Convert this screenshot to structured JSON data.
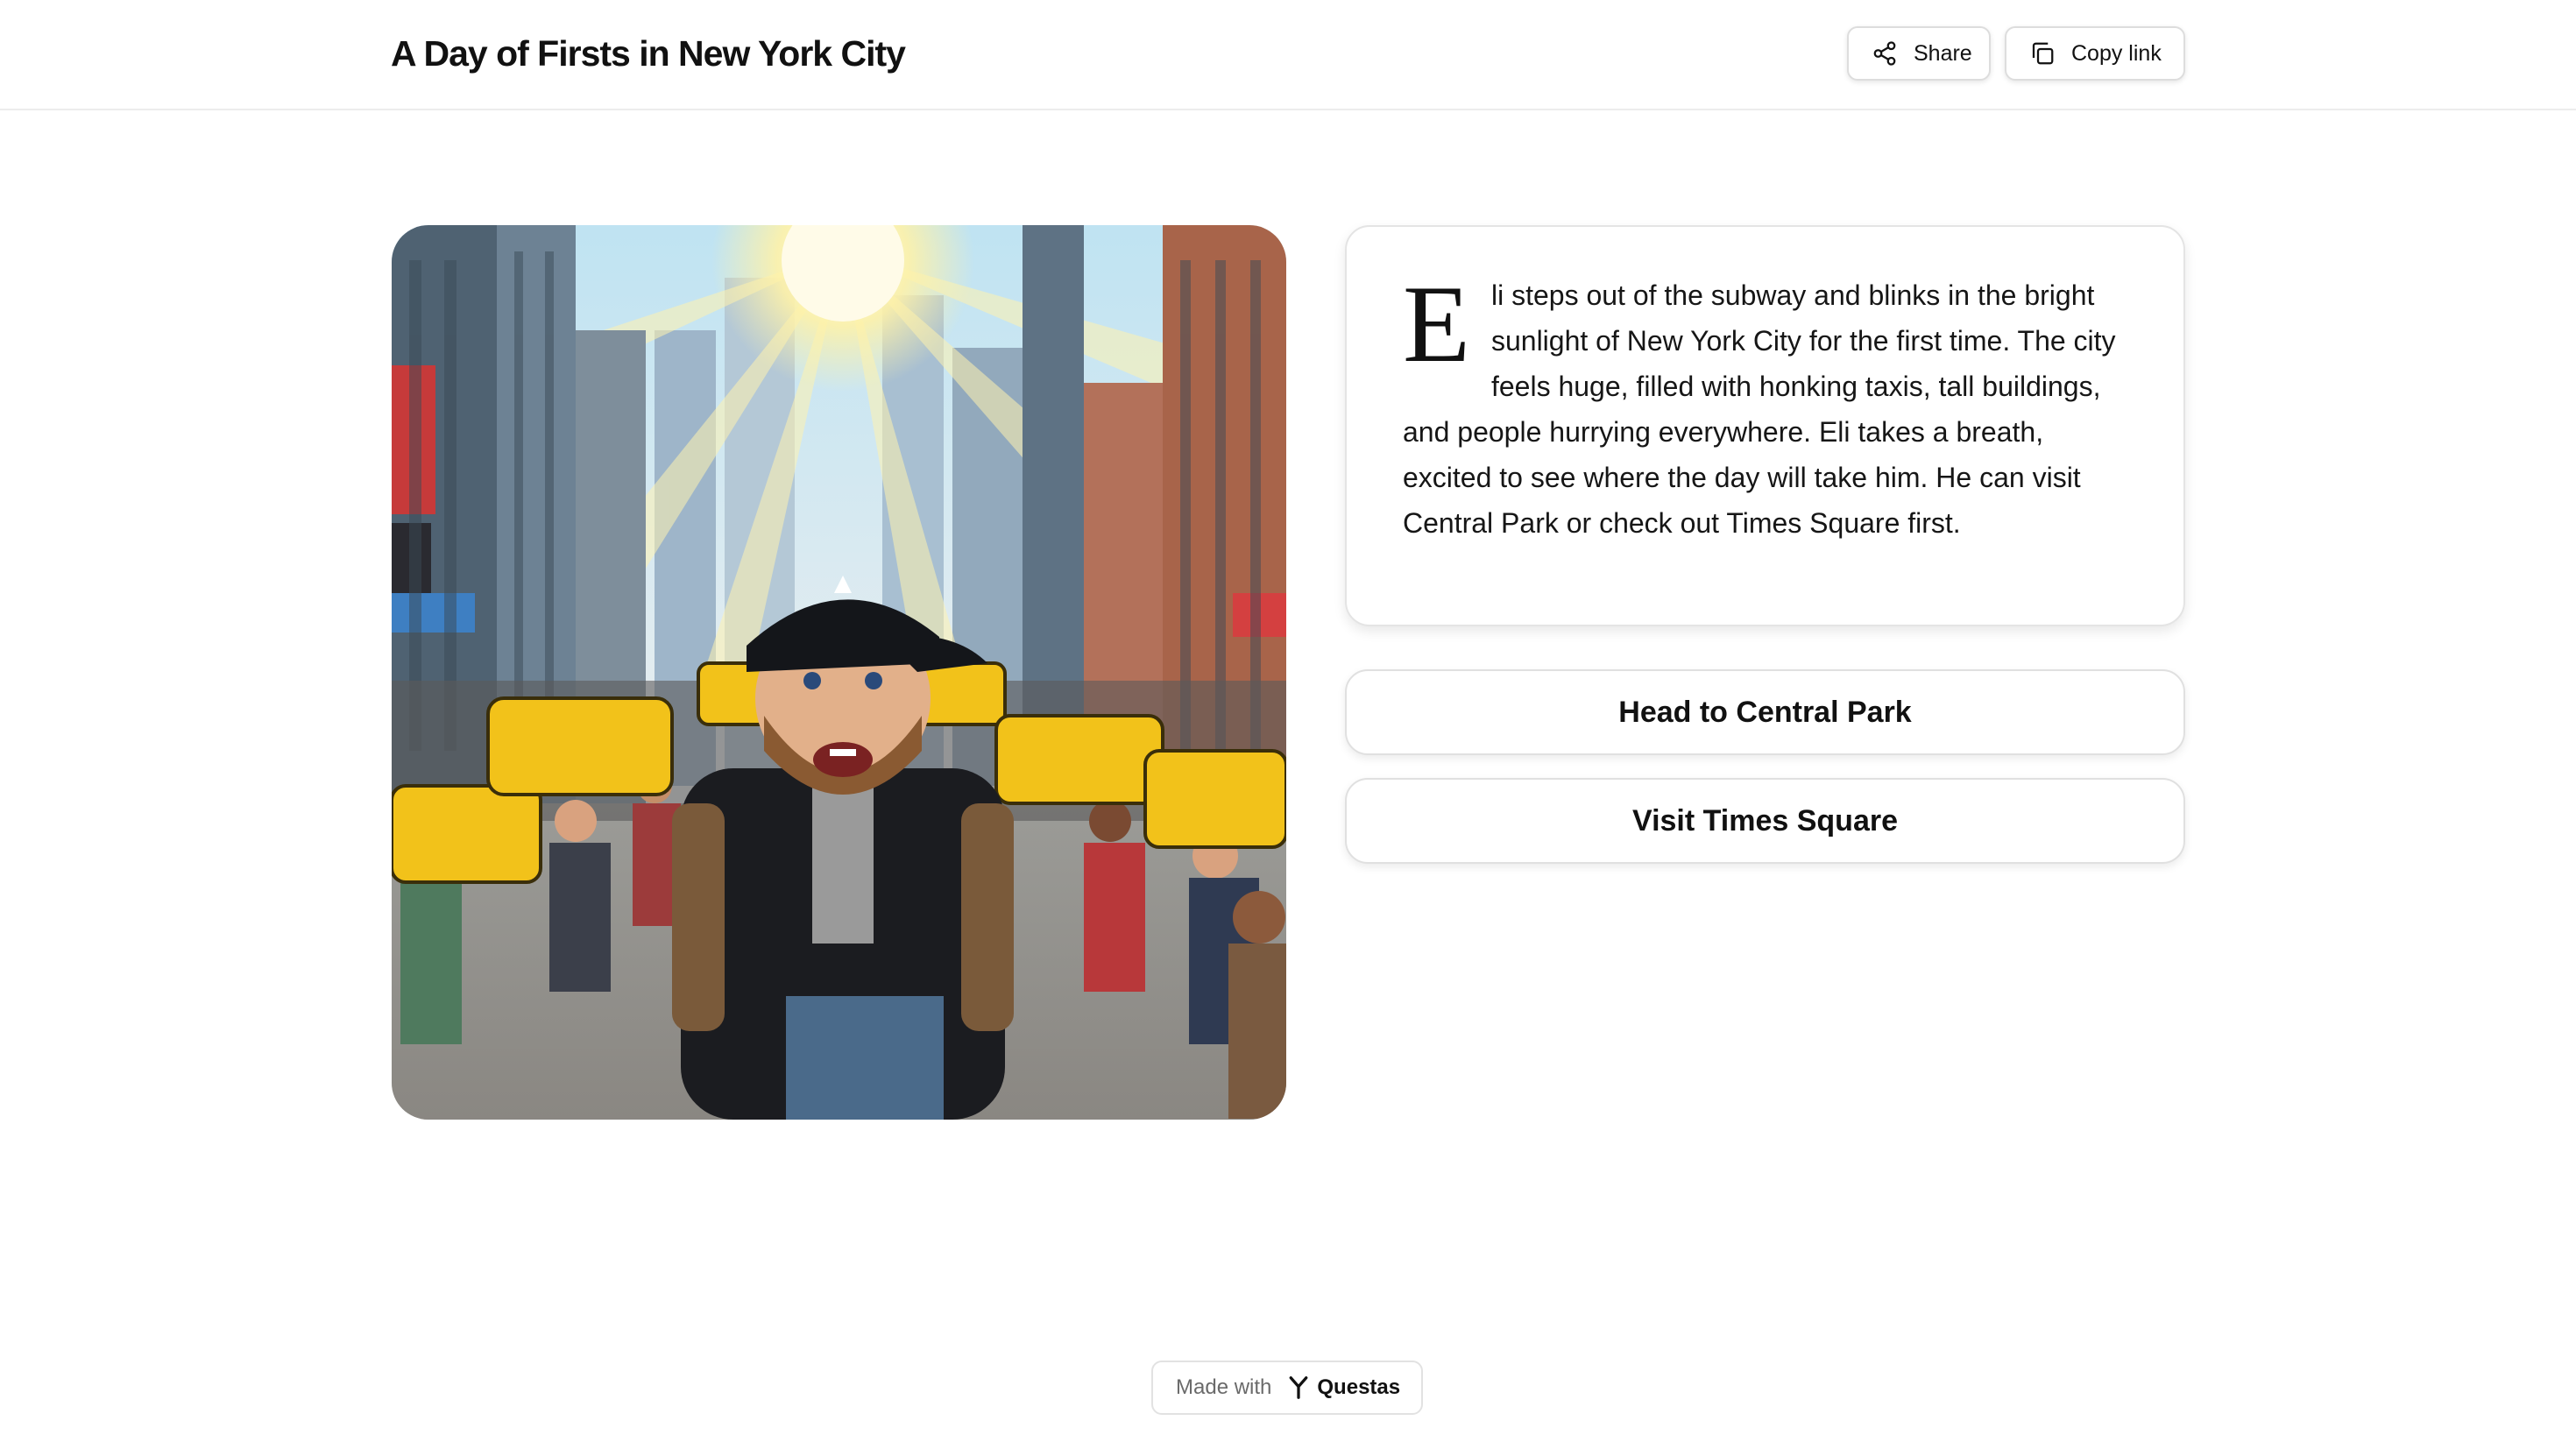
{
  "header": {
    "title": "A Day of Firsts in New York City",
    "share_label": "Share",
    "copy_link_label": "Copy link"
  },
  "story": {
    "drop_cap": "E",
    "text": "li steps out of the subway and blinks in the bright sunlight of New York City for the first time. The city feels huge, filled with honking taxis, tall buildings, and people hurrying everywhere. Eli takes a breath, excited to see where the day will take him. He can visit Central Park or check out Times Square first."
  },
  "choices": [
    {
      "label": "Head to Central Park"
    },
    {
      "label": "Visit Times Square"
    }
  ],
  "footer": {
    "made_with_label": "Made with",
    "brand_name": "Questas"
  },
  "illustration": {
    "subject": "pixel-art scene of a young man in a black cap and puffer jacket with a backpack on a busy New York street with yellow taxis, crowds and sunlight between skyscrapers"
  }
}
